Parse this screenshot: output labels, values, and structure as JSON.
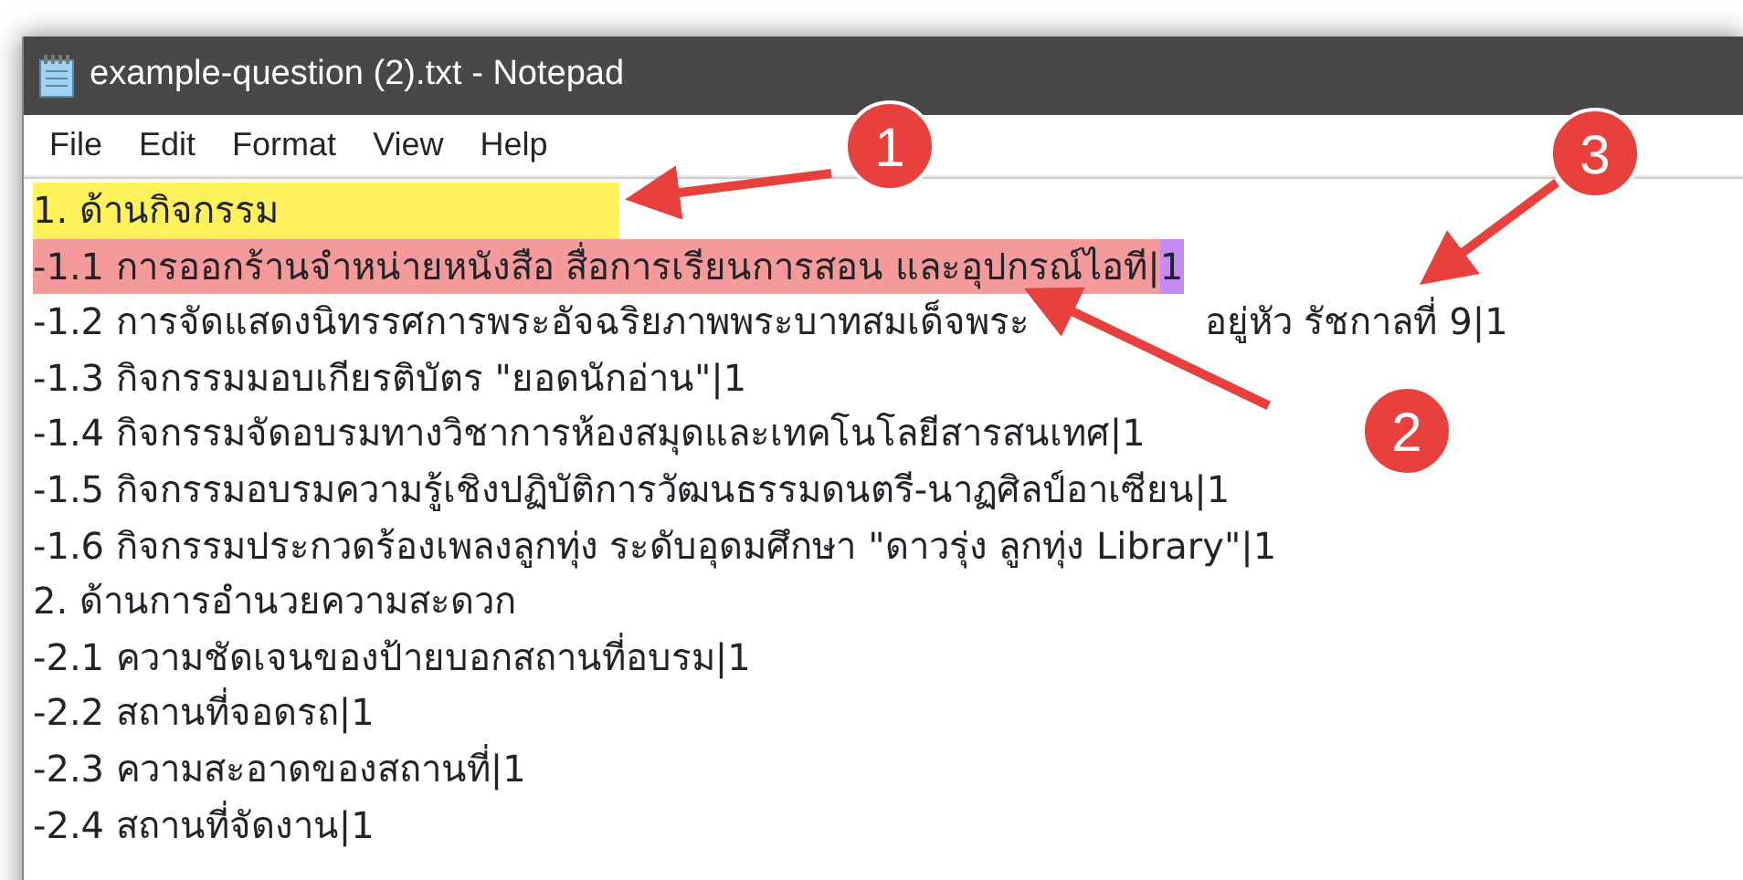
{
  "window": {
    "title": "example-question (2).txt - Notepad"
  },
  "menu": [
    "File",
    "Edit",
    "Format",
    "View",
    "Help"
  ],
  "lines": [
    [
      {
        "text": "1. ด้านกิจกรรม",
        "color": "#fff15a",
        "kind": "wide"
      }
    ],
    [
      {
        "text": "-1.1 การออกร้านจำหน่ายหนังสือ สื่อการเรียนการสอน และอุปกรณ์ไอที|",
        "color": "#f59a9a"
      },
      {
        "text": "1",
        "color": "#c58cf5"
      }
    ],
    [
      {
        "text": "-1.2 การจัดแสดงนิทรรศการพระอัจฉริยภาพพระบาทสมเด็จพระ"
      },
      {
        "text": "อยู่หัว รัชกาลที่ 9|1",
        "kind": "after-gap"
      }
    ],
    [
      {
        "text": "-1.3 กิจกรรมมอบเกียรติบัตร \"ยอดนักอ่าน\"|1"
      }
    ],
    [
      {
        "text": "-1.4 กิจกรรมจัดอบรมทางวิชาการห้องสมุดและเทคโนโลยีสารสนเทศ|1"
      }
    ],
    [
      {
        "text": "-1.5 กิจกรรมอบรมความรู้เชิงปฏิบัติการวัฒนธรรมดนตรี-นาฏศิลป์อาเซียน|1"
      }
    ],
    [
      {
        "text": "-1.6 กิจกรรมประกวดร้องเพลงลูกทุ่ง ระดับอุดมศึกษา \"ดาวรุ่ง ลูกทุ่ง Library\"|1"
      }
    ],
    [
      {
        "text": "2. ด้านการอำนวยความสะดวก"
      }
    ],
    [
      {
        "text": "-2.1 ความชัดเจนของป้ายบอกสถานที่อบรม|1"
      }
    ],
    [
      {
        "text": "-2.2 สถานที่จอดรถ|1"
      }
    ],
    [
      {
        "text": "-2.3 ความสะอาดของสถานที่|1"
      }
    ],
    [
      {
        "text": "-2.4 สถานที่จัดงาน|1"
      }
    ]
  ],
  "callouts": [
    "1",
    "2",
    "3"
  ]
}
